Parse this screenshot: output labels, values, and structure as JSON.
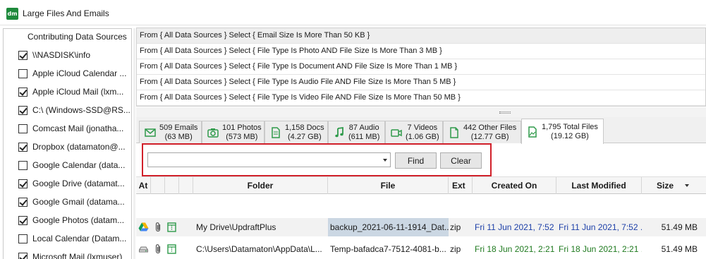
{
  "window": {
    "title": "Large Files And Emails",
    "icon_text": "dm"
  },
  "sidebar": {
    "header": "Contributing Data Sources",
    "items": [
      {
        "label": "\\\\NASDISK\\info",
        "checked": true
      },
      {
        "label": "Apple iCloud Calendar ...",
        "checked": false
      },
      {
        "label": "Apple iCloud Mail (lxm...",
        "checked": true
      },
      {
        "label": "C:\\ (Windows-SSD@RS...",
        "checked": true
      },
      {
        "label": "Comcast Mail (jonatha...",
        "checked": false
      },
      {
        "label": "Dropbox (datamaton@...",
        "checked": true
      },
      {
        "label": "Google Calendar (data...",
        "checked": false
      },
      {
        "label": "Google Drive (datamat...",
        "checked": true
      },
      {
        "label": "Google Gmail (datama...",
        "checked": true
      },
      {
        "label": "Google Photos (datam...",
        "checked": true
      },
      {
        "label": "Local Calendar (Datam...",
        "checked": false
      },
      {
        "label": "Microsoft Mail (lxmuser)",
        "checked": true
      }
    ]
  },
  "queries": [
    "From { All Data Sources } Select { Email Size Is More Than 50 KB }",
    "From { All Data Sources } Select { File Type Is Photo AND File Size Is More Than 3 MB }",
    "From { All Data Sources } Select { File Type Is Document AND File Size Is More Than 1 MB }",
    "From { All Data Sources } Select { File Type Is Audio File AND File Size Is More Than 5 MB }",
    "From { All Data Sources } Select { File Type Is Video File AND File Size Is More Than 50 MB }"
  ],
  "tabs": [
    {
      "line1": "509 Emails",
      "line2": "(63 MB)",
      "icon": "envelope-icon"
    },
    {
      "line1": "101 Photos",
      "line2": "(573 MB)",
      "icon": "camera-icon"
    },
    {
      "line1": "1,158 Docs",
      "line2": "(4.27 GB)",
      "icon": "document-icon"
    },
    {
      "line1": "87 Audio",
      "line2": "(611 MB)",
      "icon": "music-note-icon"
    },
    {
      "line1": "7 Videos",
      "line2": "(1.06 GB)",
      "icon": "video-camera-icon"
    },
    {
      "line1": "442 Other Files",
      "line2": "(12.77 GB)",
      "icon": "file-icon"
    },
    {
      "line1": "1,795 Total Files",
      "line2": "(19.12 GB)",
      "icon": "image-file-icon"
    }
  ],
  "search": {
    "value": "",
    "find_label": "Find",
    "clear_label": "Clear"
  },
  "grid": {
    "columns": {
      "at": "At",
      "folder": "Folder",
      "file": "File",
      "ext": "Ext",
      "created": "Created On",
      "modified": "Last Modified",
      "size": "Size"
    },
    "rows": [
      {
        "source_icon": "google-drive-icon",
        "folder": "My Drive\\UpdraftPlus",
        "file": "backup_2021-06-11-1914_Dat...",
        "ext": "zip",
        "created": "Fri 11 Jun 2021, 7:52 ...",
        "modified": "Fri 11 Jun 2021, 7:52 ...",
        "size": "51.49 MB"
      },
      {
        "source_icon": "local-disk-icon",
        "folder": "C:\\Users\\Datamaton\\AppData\\L...",
        "file": "Temp-bafadca7-7512-4081-b...",
        "ext": "zip",
        "created": "Fri 18 Jun 2021, 2:21 ...",
        "modified": "Fri 18 Jun 2021, 2:21 ...",
        "size": "51.49 MB"
      }
    ]
  },
  "colors": {
    "highlight_border": "#d1202a",
    "date_green": "#1f7a1f",
    "date_blue": "#1c3fa8",
    "selected_cell": "#cbd7e3"
  }
}
